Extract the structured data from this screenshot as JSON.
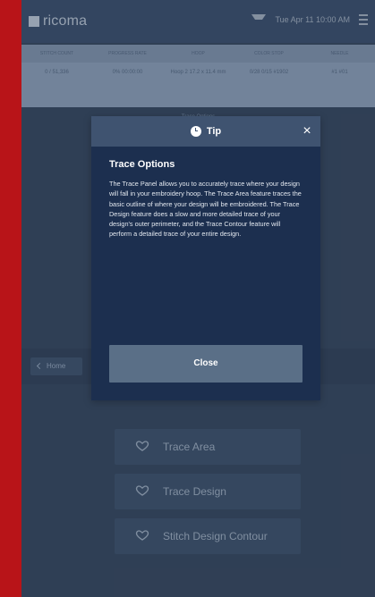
{
  "header": {
    "logo_text": "ricoma",
    "datetime": "Tue Apr 11 10:00 AM"
  },
  "table": {
    "columns": [
      "STITCH COUNT",
      "PROGRESS RATE",
      "HOOP",
      "COLOR STOP",
      "NEEDLE"
    ],
    "row": [
      "0 / 51,336",
      "0% 00:00:00",
      "Hoop 2 17.2 x 11.4 mm",
      "0/28 0/15 #1902",
      "#1 #01"
    ]
  },
  "overlay_text": "Trace Options",
  "back_button": "Home",
  "options": [
    {
      "label": "Trace Area",
      "icon": "heart-icon"
    },
    {
      "label": "Trace Design",
      "icon": "heart-icon"
    },
    {
      "label": "Stitch Design Contour",
      "icon": "heart-icon"
    }
  ],
  "modal": {
    "title": "Tip",
    "heading": "Trace Options",
    "body": "The Trace Panel allows you to accurately trace where your design will fall in your embroidery hoop. The Trace Area feature traces the basic outline of where your design will be embroidered. The Trace Design feature does a slow and more detailed trace of your design's outer perimeter, and the Trace Contour feature will perform a detailed trace of your entire design.",
    "button": "Close"
  },
  "colors": {
    "accent": "#b81418",
    "modal_bg": "#1c2f4f",
    "modal_header": "#3f5370",
    "button_bg": "#5a6f87"
  }
}
